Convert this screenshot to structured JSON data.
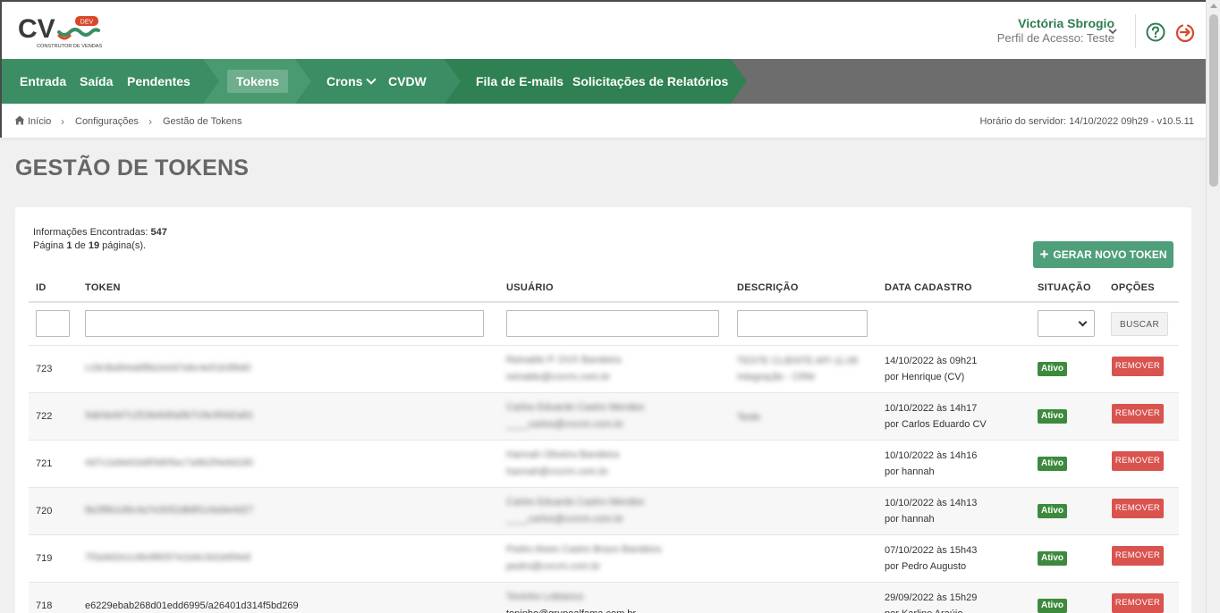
{
  "header": {
    "logo_text": "CV",
    "logo_badge": "DEV",
    "logo_subtitle": "CONSTRUTOR DE VENDAS",
    "user_name": "Victória Sbrogio",
    "user_profile": "Perfil de Acesso: Teste"
  },
  "nav": {
    "items": [
      {
        "label": "Entrada"
      },
      {
        "label": "Saída"
      },
      {
        "label": "Pendentes"
      },
      {
        "label": "Tokens"
      },
      {
        "label": "Crons"
      },
      {
        "label": "CVDW"
      },
      {
        "label": "Fila de E-mails"
      },
      {
        "label": "Solicitações de Relatórios"
      }
    ],
    "active": "Tokens"
  },
  "breadcrumb": {
    "items": [
      "Início",
      "Configurações",
      "Gestão de Tokens"
    ],
    "server_time": "Horário do servidor: 14/10/2022 09h29 - v10.5.11"
  },
  "page": {
    "title": "GESTÃO DE TOKENS",
    "info_label": "Informações Encontradas:",
    "info_count": "547",
    "pagination_prefix": "Página",
    "page_current": "1",
    "pagination_mid": "de",
    "page_total": "19",
    "pagination_suffix": "página(s).",
    "new_token_button": "GERAR NOVO TOKEN"
  },
  "table": {
    "columns": [
      "ID",
      "TOKEN",
      "USUÁRIO",
      "DESCRIÇÃO",
      "DATA CADASTRO",
      "SITUAÇÃO",
      "OPÇÕES"
    ],
    "filter_button": "BUSCAR",
    "rows": [
      {
        "id": "723",
        "token": "c1fe3bd94a6f8b2e0d7a9c4e51b3f6d0",
        "user_name": "Reinaldo P. DVX Bandeira",
        "user_email": "reinaldo@cvcrm.com.br",
        "description": "TESTE CLIENTE API 11.08",
        "description2": "Integração - CRM",
        "date": "14/10/2022 às 09h21",
        "by": "por Henrique (CV)",
        "status": "Ativo",
        "action": "REMOVER"
      },
      {
        "id": "722",
        "token": "9ab3ed47c2f18e6d0a5b7c9e3f4d2a81",
        "user_name": "Carlos Eduardo Castro Mendes",
        "user_email": "____carlos@cvcrm.com.br",
        "description": "Teste",
        "description2": "",
        "date": "10/10/2022 às 14h17",
        "by": "por Carlos Eduardo CV",
        "status": "Ativo",
        "action": "REMOVER"
      },
      {
        "id": "721",
        "token": "4d7c2a9e61b8f3d05ec7a9b2f4e6d180",
        "user_name": "Hannah Oliveira Bandeira",
        "user_email": "hannah@cvcrm.com.br",
        "description": "",
        "description2": "",
        "date": "10/10/2022 às 14h16",
        "by": "por hannah",
        "status": "Ativo",
        "action": "REMOVER"
      },
      {
        "id": "720",
        "token": "8e2f6b1d9c4a7e3052db8f1c6a9e4d27",
        "user_name": "Carlos Eduardo Castro Mendes",
        "user_email": "____carlos@cvcrm.com.br",
        "description": "",
        "description2": "",
        "date": "10/10/2022 às 14h13",
        "by": "por hannah",
        "status": "Ativo",
        "action": "REMOVER"
      },
      {
        "id": "719",
        "token": "7f3a9d2e1c6b4f8057e2a9c3d1b6f4e8",
        "user_name": "Pedro Alves Castro Bravo Bandeira",
        "user_email": "pedro@cvcrm.com.br",
        "description": "",
        "description2": "",
        "date": "07/10/2022 às 15h43",
        "by": "por Pedro Augusto",
        "status": "Ativo",
        "action": "REMOVER"
      },
      {
        "id": "718",
        "token": "e6229ebab268d01edd6995/a26401d314f5bd269",
        "user_name": "Toninho Lobianco",
        "user_email": "toninho@grupoalfama.com.br",
        "description": "",
        "description2": "",
        "date": "29/09/2022 às 15h29",
        "by": "por Karline Araújo",
        "status": "Ativo",
        "action": "REMOVER"
      }
    ]
  },
  "colors": {
    "brand_green": "#2e7d52",
    "nav_green": "#3b8d63",
    "nav_bg": "#6d6d6d",
    "button_green": "#4e9f7a",
    "badge_green": "#3d8a3d",
    "remove_red": "#d9534f",
    "logout_red": "#d9472b"
  }
}
